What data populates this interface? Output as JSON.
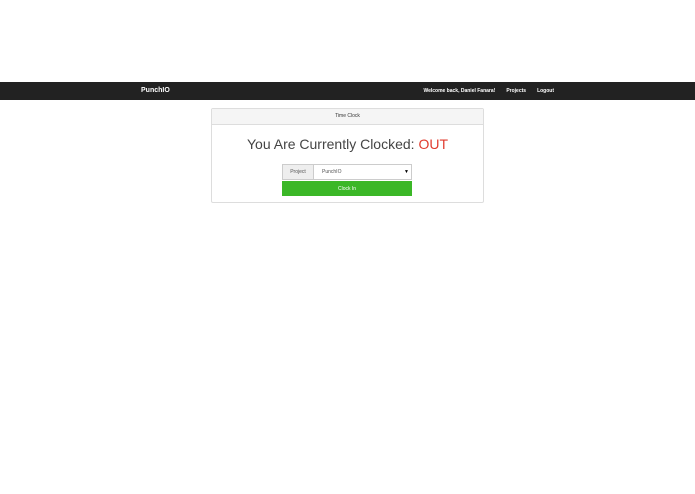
{
  "navbar": {
    "brand": "PunchIO",
    "welcome": "Welcome back, Daniel Fanara!",
    "projects_link": "Projects",
    "logout_link": "Logout",
    "background": "#222222"
  },
  "panel": {
    "heading": "Time Clock",
    "status_prefix": "You Are Currently Clocked:",
    "status_value": "OUT",
    "status_color": "#e03b2e"
  },
  "form": {
    "project_label": "Project",
    "project_selected": "PunchIO",
    "dropdown_icon": "caret-down-icon",
    "submit_label": "Clock In",
    "submit_color": "#3bb727"
  }
}
